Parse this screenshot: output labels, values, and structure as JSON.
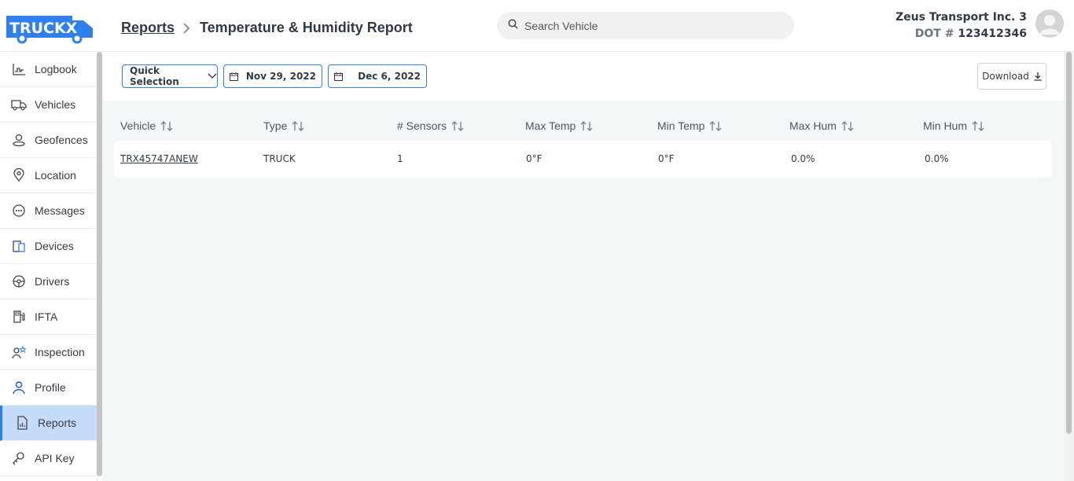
{
  "brand": {
    "logo_text": "TRUCKX",
    "accent": "#2f80ed"
  },
  "breadcrumb": {
    "parent": "Reports",
    "current": "Temperature & Humidity Report"
  },
  "search": {
    "placeholder": "Search Vehicle"
  },
  "company": {
    "name": "Zeus Transport Inc. 3",
    "dot_label": "DOT #",
    "dot_number": "123412346"
  },
  "sidebar": {
    "items": [
      {
        "label": "Logbook",
        "icon": "logbook-icon"
      },
      {
        "label": "Vehicles",
        "icon": "truck-icon"
      },
      {
        "label": "Geofences",
        "icon": "geofence-icon"
      },
      {
        "label": "Location",
        "icon": "location-pin-icon"
      },
      {
        "label": "Messages",
        "icon": "message-icon"
      },
      {
        "label": "Devices",
        "icon": "devices-icon"
      },
      {
        "label": "Drivers",
        "icon": "steering-wheel-icon"
      },
      {
        "label": "IFTA",
        "icon": "fuel-pump-icon"
      },
      {
        "label": "Inspection",
        "icon": "inspection-icon"
      },
      {
        "label": "Profile",
        "icon": "profile-icon"
      },
      {
        "label": "Reports",
        "icon": "report-icon",
        "active": true
      },
      {
        "label": "API Key",
        "icon": "key-icon"
      }
    ]
  },
  "toolbar": {
    "quick_selection": "Quick Selection",
    "date_from": "Nov 29, 2022",
    "date_to": "Dec 6, 2022",
    "download": "Download"
  },
  "table": {
    "columns": [
      "Vehicle",
      "Type",
      "# Sensors",
      "Max Temp",
      "Min Temp",
      "Max Hum",
      "Min Hum"
    ],
    "rows": [
      {
        "vehicle": "TRX45747ANEW",
        "type": "TRUCK",
        "sensors": "1",
        "max_temp": "0°F",
        "min_temp": "0°F",
        "max_hum": "0.0%",
        "min_hum": "0.0%"
      }
    ]
  }
}
